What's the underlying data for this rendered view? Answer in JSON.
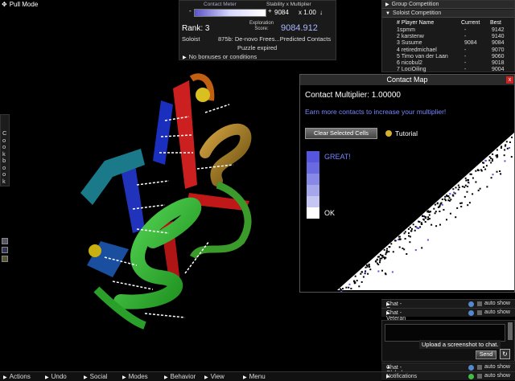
{
  "top_left": {
    "pull_mode": "Pull Mode"
  },
  "score": {
    "contact_meter_label": "Contact Meter",
    "stability_label": "Stability x  Multiplier",
    "stability_value": "9084",
    "multiplier_value": "x  1.00",
    "rank": "Rank: 3",
    "exploration_label": "Exploration Score:",
    "score_value": "9084.912",
    "soloist_label": "Soloist",
    "puzzle_name": "875b: De-novo Frees...Predicted Contacts",
    "puzzle_status": "Puzzle expired",
    "bonus_label": "No bonuses or conditions"
  },
  "leaderboard": {
    "group_tab": "Group Competition",
    "solo_tab": "Soloist Competition",
    "col_player": "# Player Name",
    "col_current": "Current",
    "col_best": "Best",
    "rows": [
      {
        "name": "1spmm",
        "current": "-",
        "best": "9142"
      },
      {
        "name": "2 karstenw",
        "current": "-",
        "best": "9140"
      },
      {
        "name": "3 Susume",
        "current": "9084",
        "best": "9084"
      },
      {
        "name": "4 retiredmichael",
        "current": "-",
        "best": "9070"
      },
      {
        "name": "5 Timo van der Laan",
        "current": "-",
        "best": "9060"
      },
      {
        "name": "6 nicobul2",
        "current": "-",
        "best": "9018"
      },
      {
        "name": "7 LociOiling",
        "current": "-",
        "best": "9004"
      }
    ]
  },
  "contact_map": {
    "title": "Contact Map",
    "close": "x",
    "multiplier": "Contact Multiplier: 1.00000",
    "hint": "Earn more contacts to increase your multiplier!",
    "clear_button": "Clear Selected Cells",
    "tutorial": "Tutorial",
    "great": "GREAT!",
    "ok": "OK"
  },
  "cookbook": {
    "label": "Cookbook"
  },
  "chat": {
    "group": "Chat - Group",
    "veteran": "Chat - Veteran",
    "global": "Chat - Global",
    "notifications": "Notifications",
    "auto_show": "auto show",
    "upload_tooltip": "Upload a screenshot to chat.",
    "send": "Send"
  },
  "menu": [
    "Actions",
    "Undo",
    "Social",
    "Modes",
    "Behavior",
    "View",
    "Menu"
  ],
  "colors": {
    "accent": "#6666ff",
    "hint_blue": "#7788ff",
    "panel": "#1a1a1a"
  }
}
